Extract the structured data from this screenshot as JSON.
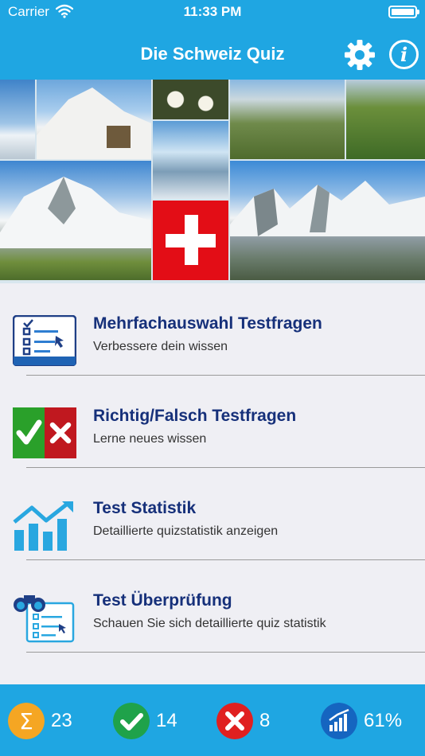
{
  "status_bar": {
    "carrier": "Carrier",
    "time": "11:33 PM"
  },
  "nav": {
    "title": "Die Schweiz Quiz",
    "settings_icon": "gear-icon",
    "info_icon": "info-icon",
    "info_glyph": "i"
  },
  "collage": {
    "tiles": [
      "alpine-peak",
      "jungfraujoch-station",
      "edelweiss",
      "glacier-lake",
      "mountain-valley",
      "alpine-flowers",
      "monch-peak",
      "swiss-flag",
      "eiger-monch-jungfrau"
    ]
  },
  "menu": {
    "items": [
      {
        "icon": "checklist-icon",
        "title": "Mehrfachauswahl Testfragen",
        "subtitle": "Verbessere dein wissen"
      },
      {
        "icon": "true-false-icon",
        "title": "Richtig/Falsch Testfragen",
        "subtitle": "Lerne neues wissen"
      },
      {
        "icon": "statistics-chart-icon",
        "title": "Test Statistik",
        "subtitle": "Detaillierte quizstatistik anzeigen"
      },
      {
        "icon": "review-binoculars-icon",
        "title": "Test Überprüfung",
        "subtitle": "Schauen Sie sich detaillierte quiz statistik"
      }
    ]
  },
  "stats": {
    "total": {
      "icon": "sum-icon",
      "glyph": "Σ",
      "value": "23",
      "color": "#f5a623"
    },
    "correct": {
      "icon": "check-icon",
      "value": "14",
      "color": "#1fa24a"
    },
    "wrong": {
      "icon": "cross-icon",
      "value": "8",
      "color": "#e02020"
    },
    "percent": {
      "icon": "growth-chart-icon",
      "value": "61%",
      "color": "#1565c0"
    }
  },
  "colors": {
    "accent": "#1fa6e2",
    "title_text": "#16307a"
  }
}
